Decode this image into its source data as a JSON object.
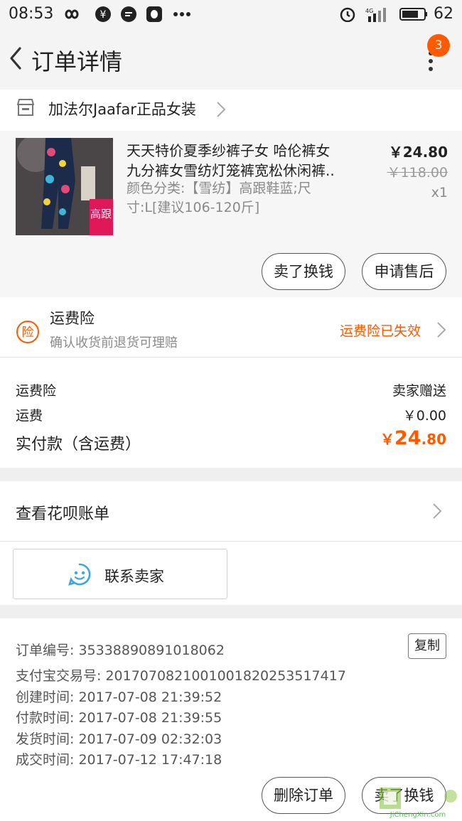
{
  "status_bar": {
    "time": "08:53",
    "battery": "62"
  },
  "header": {
    "title": "订单详情",
    "badge": "3"
  },
  "shop": {
    "name": "加法尔Jaafar正品女装"
  },
  "product": {
    "title_line1": "天天特价夏季纱裤子女 哈伦裤女",
    "title_line2": "九分裤女雪纺灯笼裤宽松休闲裤..",
    "sku_line1": "颜色分类:【雪纺】高跟鞋蓝;尺",
    "sku_line2": "寸:L[建议106-120斤]",
    "price": "￥24.80",
    "original_price": "￥118.00",
    "quantity": "x1",
    "thumb_text": "高跟"
  },
  "product_actions": {
    "sell_label": "卖了换钱",
    "after_sale_label": "申请售后"
  },
  "insurance": {
    "icon_char": "险",
    "title": "运费险",
    "desc": "确认收货前退货可理赔",
    "status": "运费险已失效"
  },
  "fees": {
    "insurance_label": "运费险",
    "insurance_value": "卖家赠送",
    "shipping_label": "运费",
    "shipping_value": "￥0.00",
    "total_label": "实付款（含运费）",
    "total_currency": "￥",
    "total_int": "24",
    "total_dec": ".80"
  },
  "huabei": {
    "label": "查看花呗账单"
  },
  "contact": {
    "label": "联系卖家"
  },
  "order_info": {
    "order_no": "订单编号: 3533889089101​8062",
    "alipay_no": "支付宝交易号: 2017070821001001820253517417",
    "created": "创建时间: 2017-07-08 21:39:52",
    "paid": "付款时间: 2017-07-08 21:39:55",
    "shipped": "发货时间: 2017-07-09 02:32:03",
    "completed": "成交时间: 2017-07-12 17:47:18",
    "copy_label": "复制"
  },
  "bottom_bar": {
    "delete_label": "删除订单",
    "sell_label": "卖了换钱"
  },
  "watermark": {
    "text": "JiChengXin.com"
  },
  "colors": {
    "accent": "#ff5a00",
    "text": "#222222",
    "muted": "#8a8a8a",
    "contact_icon": "#3aa6e8"
  }
}
